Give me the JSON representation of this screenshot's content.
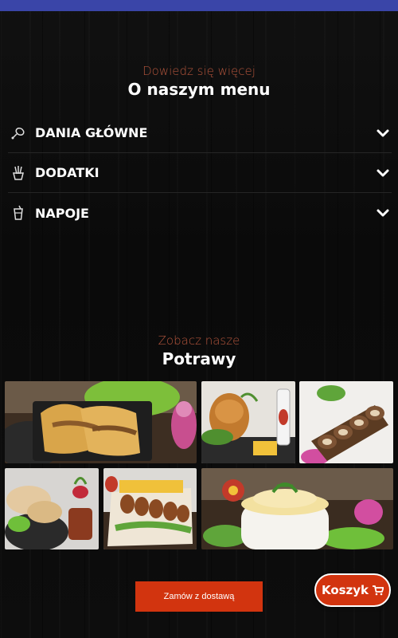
{
  "menu_section": {
    "subtitle": "Dowiedz się więcej",
    "title": "O naszym menu",
    "items": [
      {
        "label": "DANIA GŁÓWNE",
        "icon": "chicken-leg-icon"
      },
      {
        "label": "DODATKI",
        "icon": "fries-icon"
      },
      {
        "label": "NAPOJE",
        "icon": "drink-cup-icon"
      }
    ]
  },
  "dishes_section": {
    "subtitle": "Zobacz nasze",
    "title": "Potrawy",
    "photos": [
      "burrito-dish-photo",
      "roast-chicken-photo",
      "pancake-rolls-photo",
      "wraps-photo",
      "skewers-fries-photo",
      "mashed-potatoes-photo"
    ]
  },
  "footer": {
    "order_button": "Zamów z dostawą",
    "cart_button": "Koszyk",
    "cart_icon": "cart-icon"
  },
  "colors": {
    "accent": "#d2340f",
    "subtitle": "#b4553c",
    "status_bar": "#3a45a8",
    "background": "#0b0b0b"
  }
}
